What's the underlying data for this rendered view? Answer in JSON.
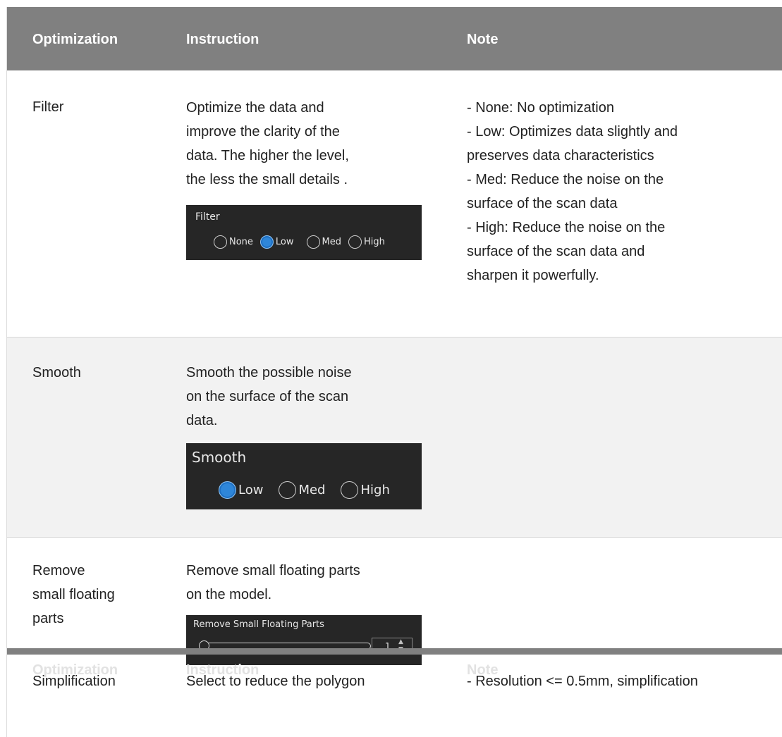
{
  "header": {
    "col1": "Optimization",
    "col2": "Instruction",
    "col3": "Note"
  },
  "rows": [
    {
      "name": "Filter",
      "instruction": [
        "Optimize the data and",
        "improve the clarity of the",
        "data. The higher the level,",
        "the less the small details ."
      ],
      "note": [
        "- None: No optimization",
        "- Low: Optimizes data slightly and",
        "preserves data characteristics",
        "- Med: Reduce the noise on the",
        "surface of the scan data",
        "- High: Reduce the noise on the",
        "surface of the scan data and",
        "sharpen it powerfully."
      ],
      "widget": {
        "title": "Filter",
        "options": [
          "None",
          "Low",
          "Med",
          "High"
        ],
        "selected": "Low"
      }
    },
    {
      "name": "Smooth",
      "instruction": [
        "Smooth the possible noise",
        "on the surface of the scan",
        "data."
      ],
      "widget": {
        "title": "Smooth",
        "options": [
          "Low",
          "Med",
          "High"
        ],
        "selected": "Low"
      }
    },
    {
      "name": [
        "Remove",
        "small floating",
        "parts"
      ],
      "instruction": [
        "Remove small floating parts",
        "on the model."
      ],
      "widget": {
        "title": "Remove Small Floating Parts",
        "value": "1"
      }
    },
    {
      "name": "Simplification",
      "instruction": [
        "Select to reduce the polygon"
      ],
      "note": [
        "- Resolution <= 0.5mm, simplification"
      ]
    }
  ],
  "colors": {
    "header_bg": "#808080",
    "widget_bg": "#262626",
    "radio_selected": "#2e86d9",
    "alt_row_bg": "#f2f2f2"
  }
}
